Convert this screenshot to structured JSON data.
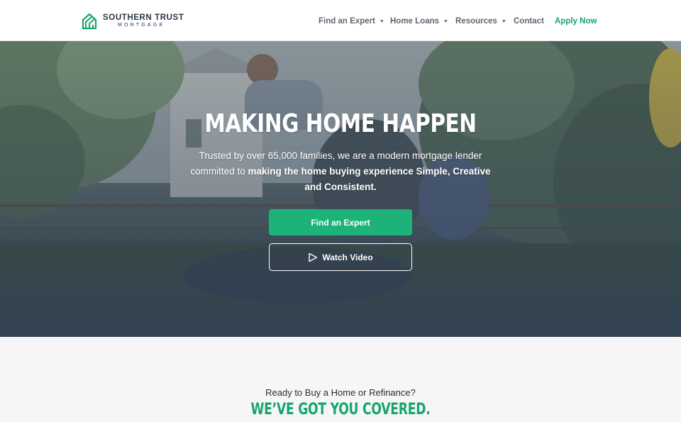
{
  "brand": {
    "name_line1": "SOUTHERN TRUST",
    "name_line2": "MORTGAGE",
    "logo_icon": "house-stripes-logo",
    "accent_color": "#16a56e"
  },
  "nav": {
    "items": [
      {
        "label": "Find an Expert",
        "has_dropdown": true
      },
      {
        "label": "Home Loans",
        "has_dropdown": true
      },
      {
        "label": "Resources",
        "has_dropdown": true
      },
      {
        "label": "Contact",
        "has_dropdown": false
      },
      {
        "label": "Apply Now",
        "has_dropdown": false
      }
    ],
    "caret_icon": "caret-down-icon"
  },
  "hero": {
    "title": "MAKING HOME HAPPEN",
    "subtitle_plain": "Trusted by over 65,000 families, we are a modern mortgage lender committed to ",
    "subtitle_bold": "making the home buying experience Simple, Creative and Consistent.",
    "primary_button": "Find an Expert",
    "secondary_button": "Watch Video",
    "play_icon": "play-outline-icon",
    "primary_color": "#1db27a"
  },
  "section": {
    "kicker": "Ready to Buy a Home or Refinance?",
    "title": "WE’VE GOT YOU COVERED."
  }
}
